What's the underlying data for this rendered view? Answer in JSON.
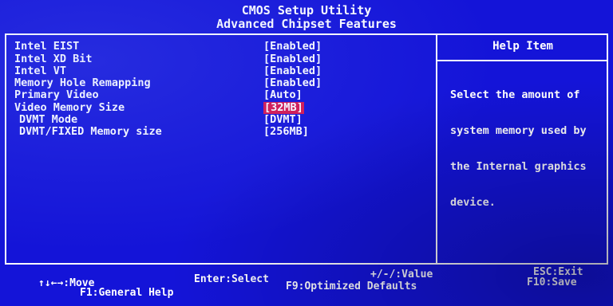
{
  "header": {
    "title": "CMOS Setup Utility",
    "subtitle": "Advanced Chipset Features"
  },
  "settings": [
    {
      "label": "Intel EIST",
      "value": "[Enabled]"
    },
    {
      "label": "Intel XD Bit",
      "value": "[Enabled]"
    },
    {
      "label": "Intel VT",
      "value": "[Enabled]"
    },
    {
      "label": "Memory Hole Remapping",
      "value": "[Enabled]"
    },
    {
      "label": "Primary Video",
      "value": "[Auto]"
    },
    {
      "label": "Video Memory Size",
      "value": "[32MB]",
      "selected": true
    },
    {
      "label": "DVMT Mode",
      "value": "[DVMT]"
    },
    {
      "label": "DVMT/FIXED Memory size",
      "value": "[256MB]"
    }
  ],
  "help": {
    "title": "Help Item",
    "lines": [
      "Select the amount of",
      "system memory used by",
      "the Internal graphics",
      "device."
    ]
  },
  "footer": {
    "move": "↑↓←→:Move",
    "select": "Enter:Select",
    "value": "+/-/:Value",
    "exit": "ESC:Exit",
    "general_help": "F1:General Help",
    "optimized_defaults": "F9:Optimized Defaults",
    "save": "F10:Save"
  },
  "colors": {
    "background": "#1414d8",
    "text": "#ffffff",
    "highlight": "#d8164e"
  }
}
